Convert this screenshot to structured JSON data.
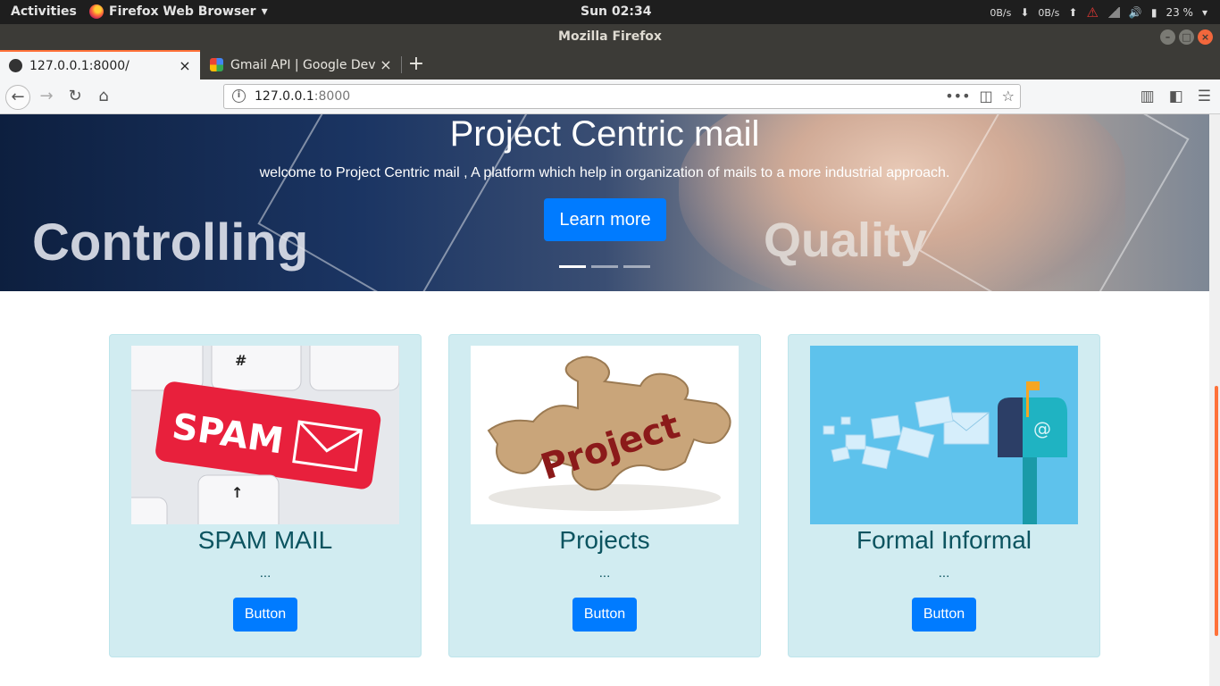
{
  "system_bar": {
    "activities": "Activities",
    "app_name": "Firefox Web Browser",
    "clock": "Sun 02:34",
    "net_down": "0B/s",
    "net_up": "0B/s",
    "battery": "23 %"
  },
  "window": {
    "title": "Mozilla Firefox"
  },
  "tabs": [
    {
      "label": "127.0.0.1:8000/",
      "close": "×"
    },
    {
      "label": "Gmail API | Google Deve",
      "close": "×"
    }
  ],
  "new_tab": "+",
  "url": {
    "host": "127.0.0.1",
    "port": ":8000"
  },
  "hero": {
    "title": "Project Centric mail",
    "subtitle": "welcome to Project Centric mail , A platform which help in organization of mails to a more industrial approach.",
    "button": "Learn more",
    "image_word_left": "Controlling",
    "image_word_right": "Quality",
    "slides": 3,
    "active_slide": 1
  },
  "cards": [
    {
      "title": "SPAM MAIL",
      "text": "...",
      "button": "Button",
      "image_text": "SPAM"
    },
    {
      "title": "Projects",
      "text": "...",
      "button": "Button",
      "image_text": "Project"
    },
    {
      "title": "Formal Informal",
      "text": "...",
      "button": "Button",
      "image_text": "@"
    }
  ],
  "colors": {
    "primary": "#007bff",
    "card_bg": "#d1ecf1",
    "card_text": "#0c5460",
    "accent": "#ff7139"
  }
}
